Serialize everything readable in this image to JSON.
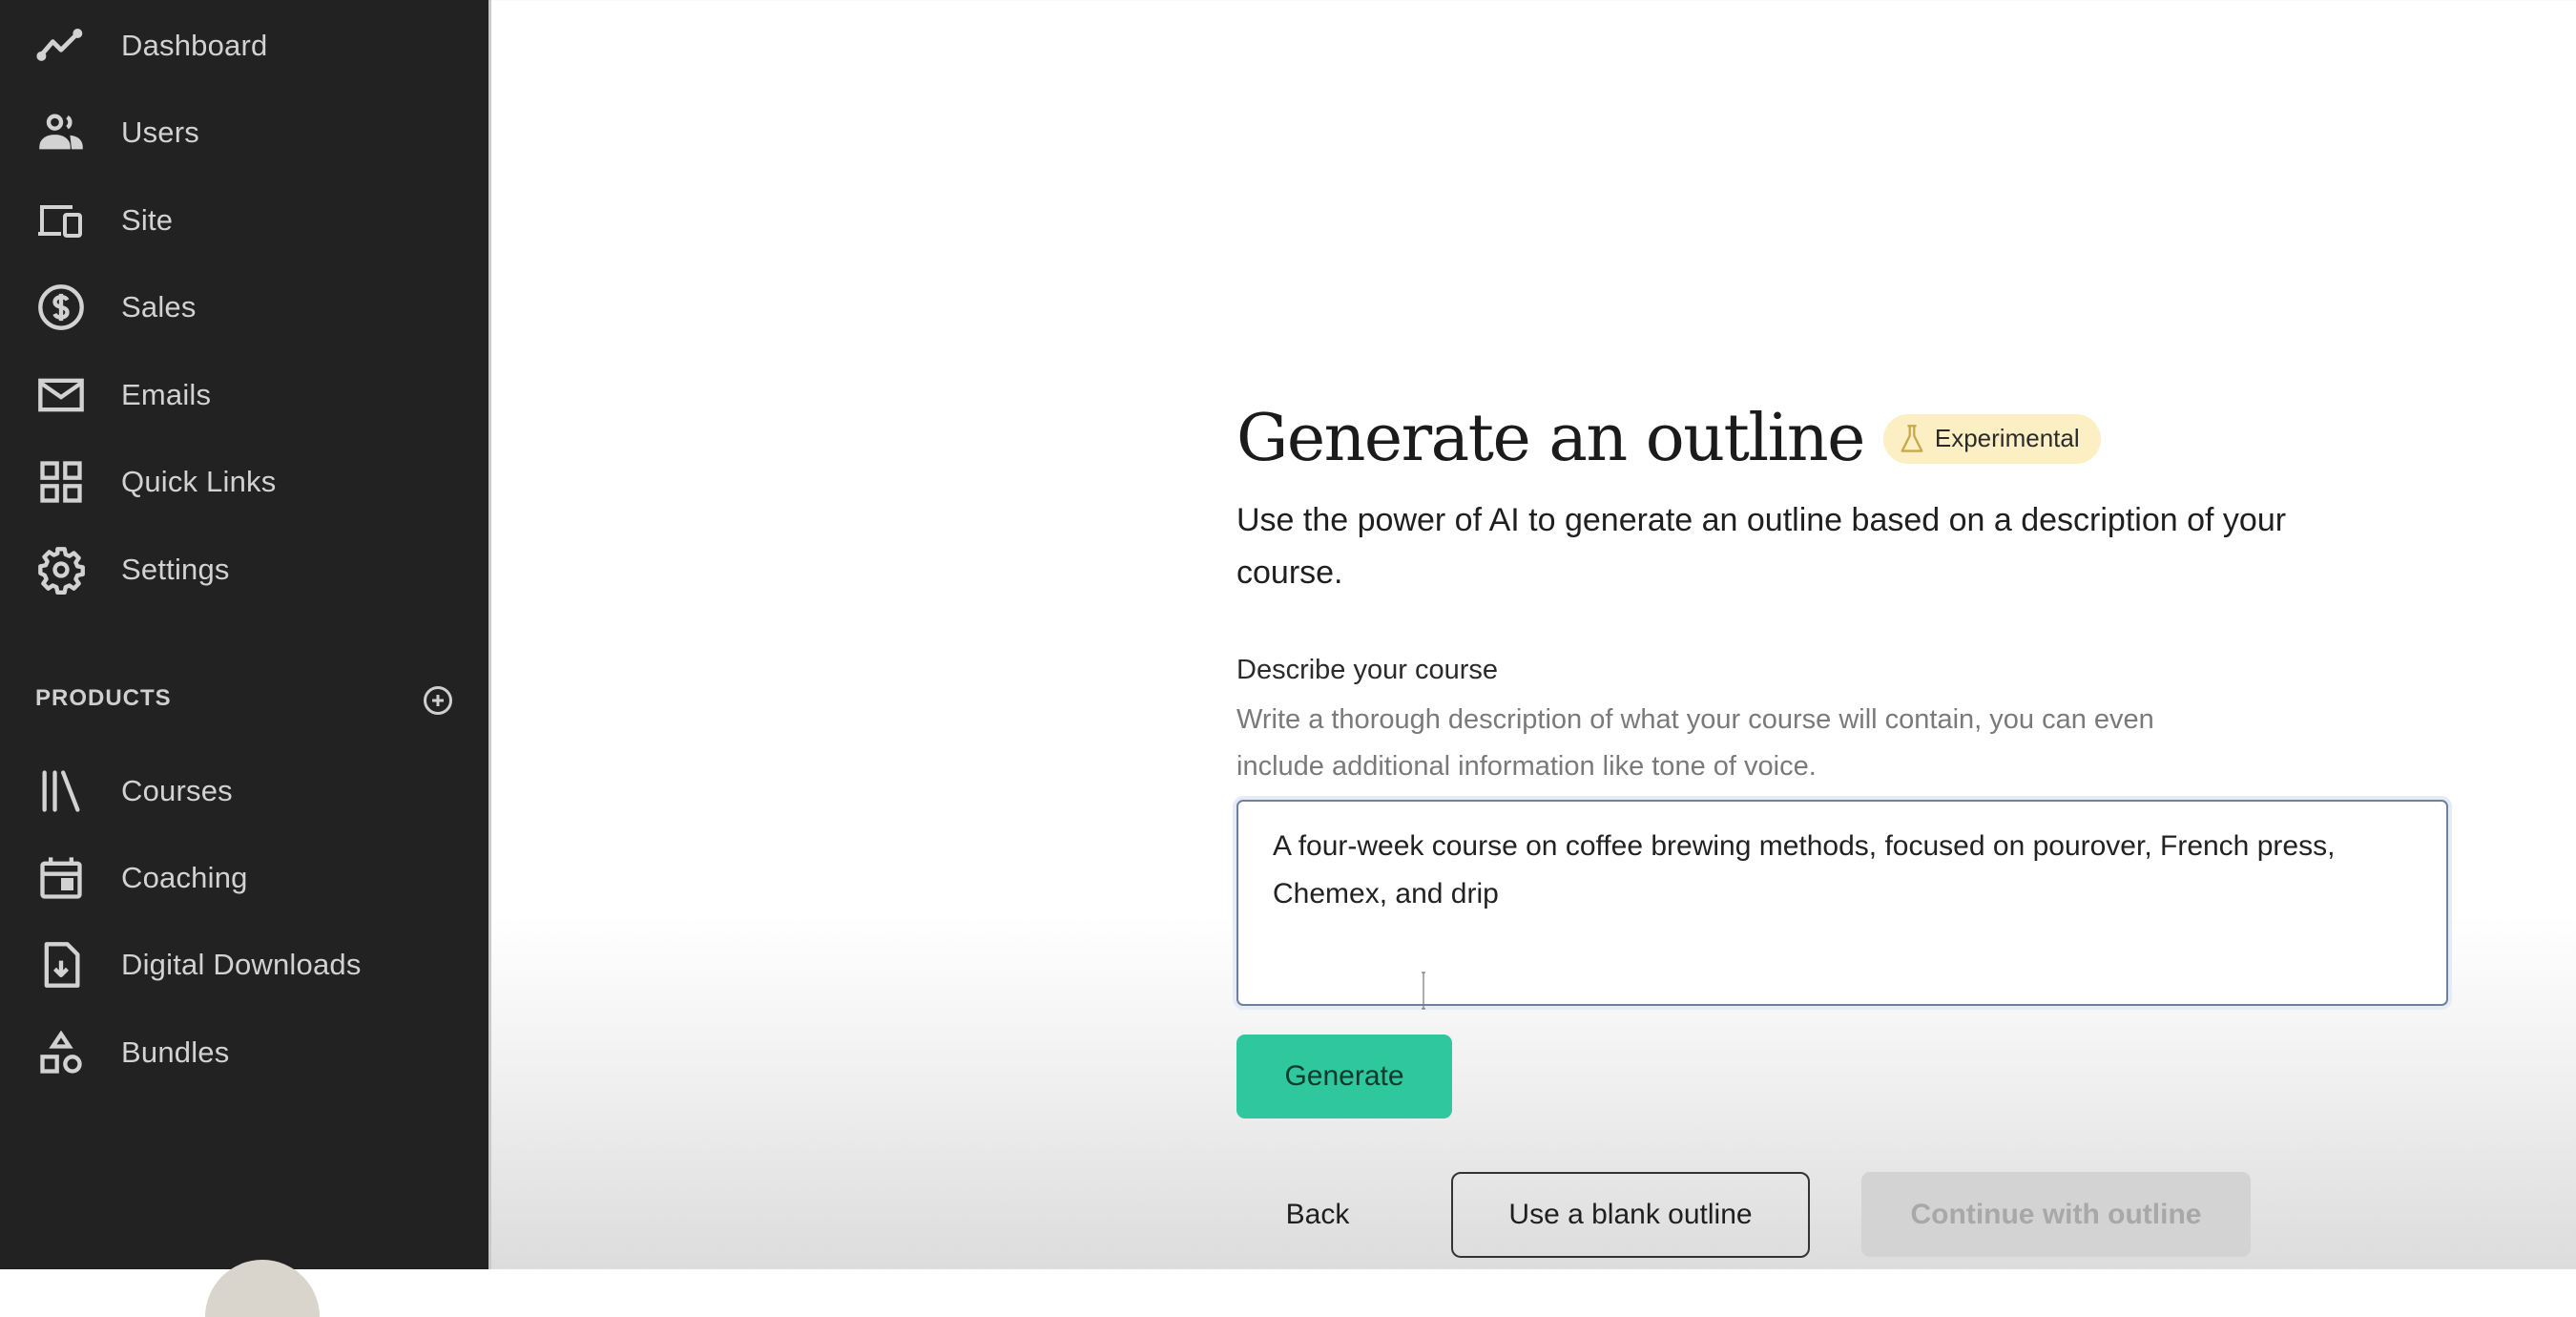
{
  "sidebar": {
    "items": [
      {
        "label": "Dashboard",
        "icon": "chart-line-icon"
      },
      {
        "label": "Users",
        "icon": "users-icon"
      },
      {
        "label": "Site",
        "icon": "devices-icon"
      },
      {
        "label": "Sales",
        "icon": "dollar-circle-icon"
      },
      {
        "label": "Emails",
        "icon": "envelope-icon"
      },
      {
        "label": "Quick Links",
        "icon": "grid-icon"
      },
      {
        "label": "Settings",
        "icon": "gear-icon"
      }
    ],
    "products_title": "PRODUCTS",
    "add_product_icon": "plus-circle-icon",
    "products": [
      {
        "label": "Courses",
        "icon": "library-icon"
      },
      {
        "label": "Coaching",
        "icon": "calendar-icon"
      },
      {
        "label": "Digital Downloads",
        "icon": "file-download-icon"
      },
      {
        "label": "Bundles",
        "icon": "shapes-icon"
      }
    ]
  },
  "main": {
    "title": "Generate an outline",
    "badge": {
      "label": "Experimental",
      "icon": "flask-icon",
      "color": "#fcefc4"
    },
    "subtitle": "Use the power of AI to generate an outline based on a description of your course.",
    "form": {
      "label": "Describe your course",
      "help": "Write a thorough description of what your course will contain, you can even include additional information like tone of voice.",
      "value": "A four-week course on coffee brewing methods, focused on pourover, French press, Chemex, and drip"
    },
    "buttons": {
      "generate": "Generate",
      "back": "Back",
      "blank": "Use a blank outline",
      "continue": "Continue with outline"
    },
    "colors": {
      "accent": "#2ec79e",
      "sidebar_bg": "#222222",
      "disabled": "#d3d3d3"
    }
  }
}
